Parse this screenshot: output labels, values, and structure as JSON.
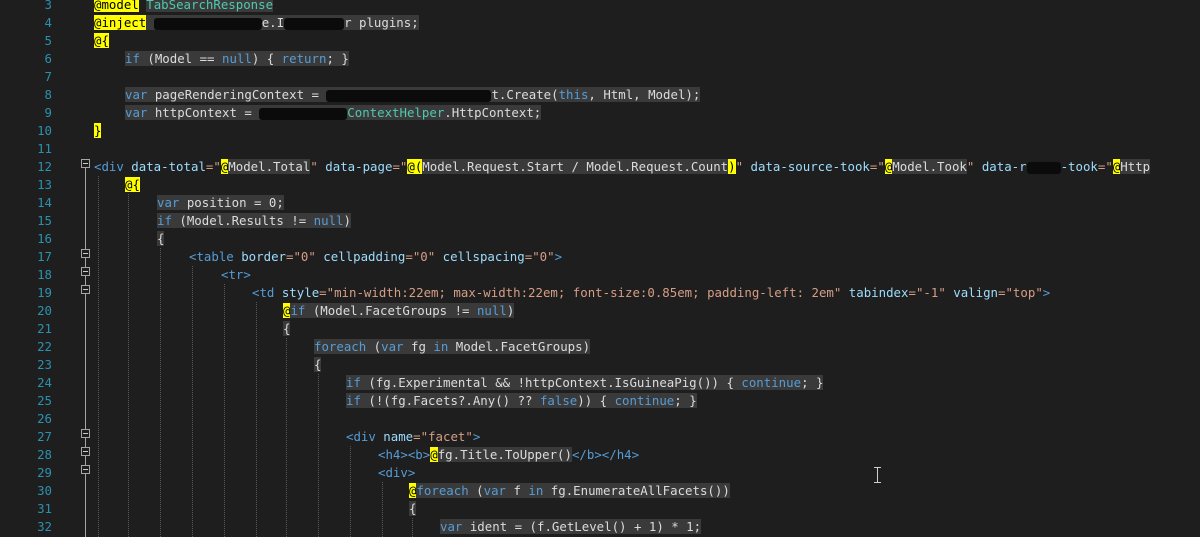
{
  "editor": {
    "line_numbers": [
      "3",
      "4",
      "5",
      "6",
      "7",
      "8",
      "9",
      "10",
      "11",
      "12",
      "13",
      "14",
      "15",
      "16",
      "17",
      "18",
      "19",
      "20",
      "21",
      "22",
      "23",
      "24",
      "25",
      "26",
      "27",
      "28",
      "29",
      "30",
      "31",
      "32"
    ],
    "lines": {
      "l3_a": "@model",
      "l3_b": "TabSearchResponse",
      "l4_a": "@inject",
      "l4_b": "e.I",
      "l4_c": "r plugins;",
      "l5": "@{",
      "l6_a": "if",
      "l6_b": " (Model == ",
      "l6_c": "null",
      "l6_d": ") { ",
      "l6_e": "return",
      "l6_f": "; }",
      "l8_a": "var",
      "l8_b": " pageRenderingContext = ",
      "l8_c": "t.Create(",
      "l8_d": "this",
      "l8_e": ", Html, Model);",
      "l9_a": "var",
      "l9_b": " httpContext = ",
      "l9_c": "ContextHelper",
      "l9_d": ".HttpContext;",
      "l10": "}",
      "l12_a": "<div",
      "l12_b": " data-total",
      "l12_c": "=\"",
      "l12_d": "@",
      "l12_e": "Model.Total",
      "l12_f": "\"",
      "l12_g": " data-page",
      "l12_h": "=\"",
      "l12_i": "@(",
      "l12_j": "Model.Request.Start / Model.Request.Count",
      "l12_k": ")",
      "l12_l": "\"",
      "l12_m": " data-source-took",
      "l12_n": "=\"",
      "l12_o": "@",
      "l12_p": "Model.Took",
      "l12_q": "\"",
      "l12_r": " data-r",
      "l12_s": "-took",
      "l12_t": "=\"",
      "l12_u": "@",
      "l12_v": "Http",
      "l13": "@{",
      "l14_a": "var",
      "l14_b": " position = 0;",
      "l15_a": "if",
      "l15_b": " (Model.Results != ",
      "l15_c": "null",
      "l15_d": ")",
      "l16": "{",
      "l17_a": "<table",
      "l17_b": " border",
      "l17_c": "=\"0\"",
      "l17_d": " cellpadding",
      "l17_e": "=\"0\"",
      "l17_f": " cellspacing",
      "l17_g": "=\"0\"",
      "l17_h": ">",
      "l18": "<tr>",
      "l19_a": "<td",
      "l19_b": " style",
      "l19_c": "=\"min-width:22em; max-width:22em; font-size:0.85em; padding-left: 2em\"",
      "l19_d": " tabindex",
      "l19_e": "=\"-1\"",
      "l19_f": " valign",
      "l19_g": "=\"top\"",
      "l19_h": ">",
      "l20_a": "@",
      "l20_b": "if",
      "l20_c": " (Model.FacetGroups != ",
      "l20_d": "null",
      "l20_e": ")",
      "l21": "{",
      "l22_a": "foreach",
      "l22_b": " (",
      "l22_c": "var",
      "l22_d": " fg ",
      "l22_e": "in",
      "l22_f": " Model.FacetGroups)",
      "l23": "{",
      "l24_a": "if",
      "l24_b": " (fg.Experimental && !httpContext.IsGuineaPig()) { ",
      "l24_c": "continue",
      "l24_d": "; }",
      "l25_a": "if",
      "l25_b": " (!(fg.Facets?.Any() ?? ",
      "l25_c": "false",
      "l25_d": ")) { ",
      "l25_e": "continue",
      "l25_f": "; }",
      "l27_a": "<div",
      "l27_b": " name",
      "l27_c": "=\"facet\"",
      "l27_d": ">",
      "l28_a": "<h4><b>",
      "l28_b": "@",
      "l28_c": "fg.Title.ToUpper()",
      "l28_d": "</b></h4>",
      "l29": "<div>",
      "l30_a": "@",
      "l30_b": "foreach",
      "l30_c": " (",
      "l30_d": "var",
      "l30_e": " f ",
      "l30_f": "in",
      "l30_g": " fg.EnumerateAllFacets())",
      "l31": "{",
      "l32_a": "var",
      "l32_b": " ident = (f.GetLevel() + 1) * 1;"
    }
  }
}
